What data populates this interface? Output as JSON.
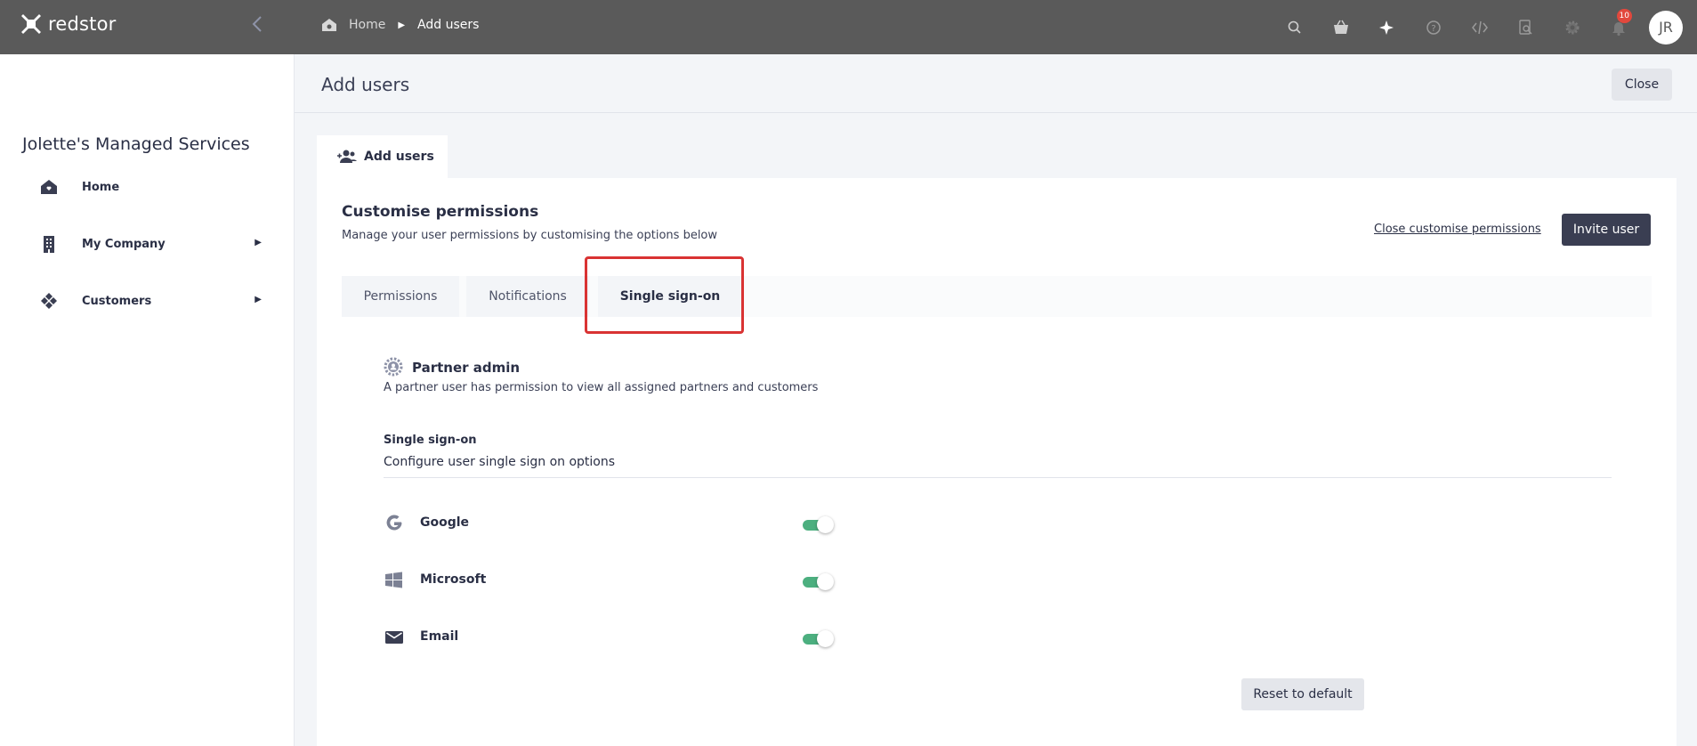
{
  "topbar": {
    "brand": "redstor",
    "breadcrumb": {
      "home": "Home",
      "current": "Add users"
    },
    "notification_count": "10",
    "avatar_initials": "JR",
    "icons": [
      "search-icon",
      "basket-icon",
      "sparkle-icon",
      "help-icon",
      "code-icon",
      "search-doc-icon",
      "gear-icon",
      "bell-icon"
    ]
  },
  "sidebar": {
    "org_name": "Jolette's Managed Services",
    "items": [
      {
        "label": "Home",
        "icon": "home-icon"
      },
      {
        "label": "My Company",
        "icon": "building-icon"
      },
      {
        "label": "Customers",
        "icon": "customers-icon"
      }
    ]
  },
  "header": {
    "title": "Add users",
    "close_label": "Close"
  },
  "card_tab": {
    "label": "Add users"
  },
  "permissions": {
    "title": "Customise permissions",
    "subtitle": "Manage your user permissions by customising the options below",
    "close_link": "Close customise permissions",
    "invite_label": "Invite user",
    "tabs": [
      {
        "label": "Permissions"
      },
      {
        "label": "Notifications"
      },
      {
        "label": "Single sign-on"
      }
    ],
    "active_tab": "Single sign-on"
  },
  "role": {
    "title": "Partner admin",
    "description": "A partner user has permission to view all assigned partners and customers"
  },
  "sso": {
    "label": "Single sign-on",
    "description": "Configure user single sign on options",
    "providers": [
      {
        "name": "Google",
        "enabled": true
      },
      {
        "name": "Microsoft",
        "enabled": true
      },
      {
        "name": "Email",
        "enabled": true
      }
    ],
    "reset_label": "Reset to default"
  },
  "colors": {
    "topbar": "#5a5a5a",
    "accent_dark": "#3a3e52",
    "toggle_on": "#4caf7f",
    "highlight": "#d93333",
    "badge": "#e2483d"
  }
}
